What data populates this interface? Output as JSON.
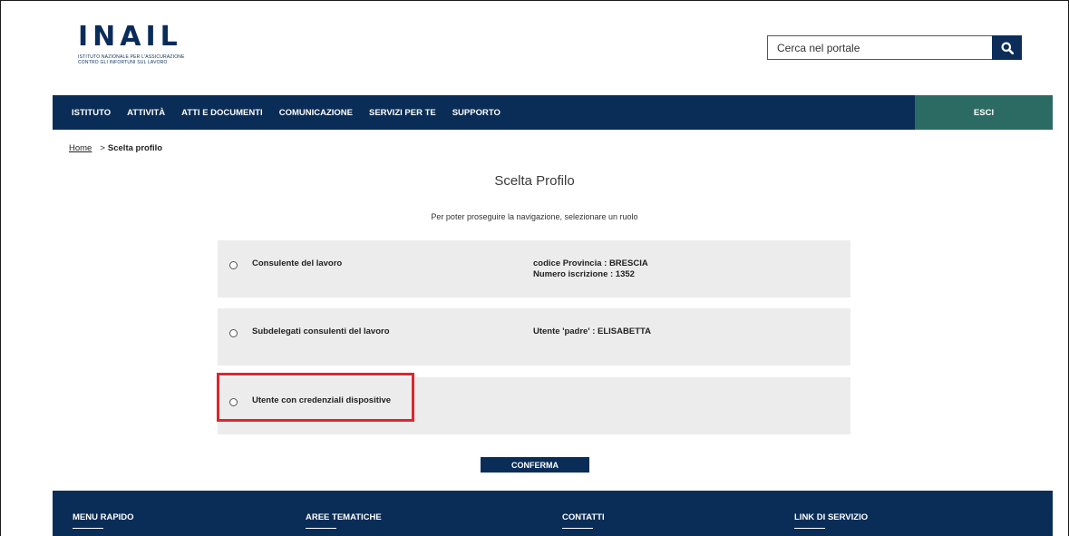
{
  "header": {
    "logo": {
      "word": "INAIL",
      "subtitle": "ISTITUTO NAZIONALE PER L'ASSICURAZIONE CONTRO GLI INFORTUNI SUL LAVORO"
    },
    "search": {
      "placeholder": "Cerca nel portale",
      "icon": "search-icon"
    }
  },
  "nav": {
    "items": [
      "ISTITUTO",
      "ATTIVITÀ",
      "ATTI E DOCUMENTI",
      "COMUNICAZIONE",
      "SERVIZI PER TE",
      "SUPPORTO"
    ],
    "logout": "ESCI",
    "colors": {
      "bar": "#0a2d58",
      "logout": "#2c6b63"
    }
  },
  "breadcrumb": {
    "home": "Home",
    "separator": ">",
    "current": "Scelta profilo"
  },
  "main": {
    "title": "Scelta Profilo",
    "intro": "Per poter proseguire la navigazione, selezionare un ruolo",
    "roles": [
      {
        "label": "Consulente del lavoro",
        "detail_line1": "codice Provincia : BRESCIA",
        "detail_line2": "Numero iscrizione : 1352"
      },
      {
        "label": "Subdelegati consulenti del lavoro",
        "detail_line1": "Utente 'padre' : ELISABETTA",
        "detail_line2": ""
      },
      {
        "label": "Utente con credenziali dispositive",
        "detail_line1": "",
        "detail_line2": ""
      }
    ],
    "confirm_label": "CONFERMA",
    "highlight_color": "#e0262b"
  },
  "footer": {
    "columns": [
      "MENU RAPIDO",
      "AREE TEMATICHE",
      "CONTATTI",
      "LINK DI SERVIZIO"
    ]
  }
}
